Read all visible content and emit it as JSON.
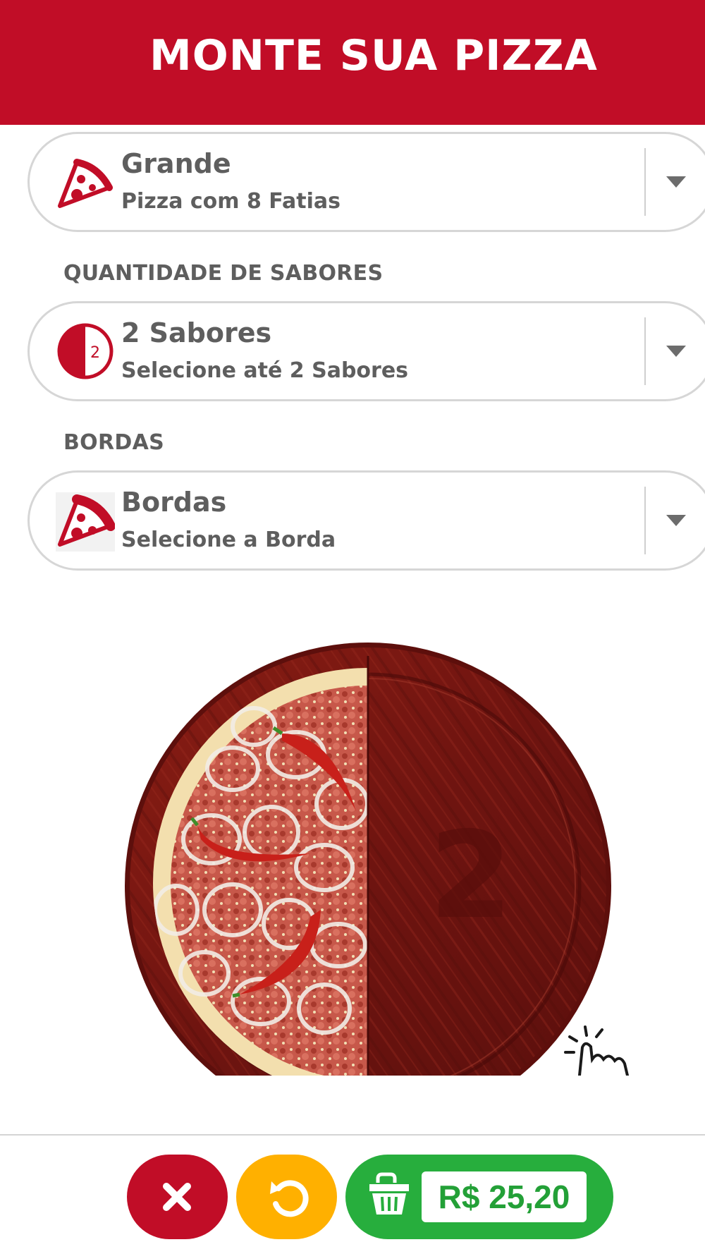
{
  "header": {
    "title": "MONTE SUA PIZZA"
  },
  "size_selector": {
    "icon": "pizza-slice-icon",
    "title": "Grande",
    "subtitle": "Pizza com 8 Fatias"
  },
  "flavors_section": {
    "label": "QUANTIDADE DE SABORES",
    "icon": "half-circle-icon",
    "icon_number": "2",
    "title": "2 Sabores",
    "subtitle": "Selecione até 2 Sabores"
  },
  "crust_section": {
    "label": "BORDAS",
    "icon": "pizza-slice-icon",
    "title": "Bordas",
    "subtitle": "Selecione a Borda"
  },
  "pizza_preview": {
    "empty_slot_number": "2",
    "hint_icon": "tap-hand-icon"
  },
  "footer": {
    "cancel_icon": "close-icon",
    "reset_icon": "undo-icon",
    "cart_icon": "basket-icon",
    "price": "R$ 25,20"
  },
  "colors": {
    "brand_red": "#c10d27",
    "reset_yellow": "#ffb000",
    "cart_green": "#27ae3d",
    "board_wood": "#7a1410"
  }
}
